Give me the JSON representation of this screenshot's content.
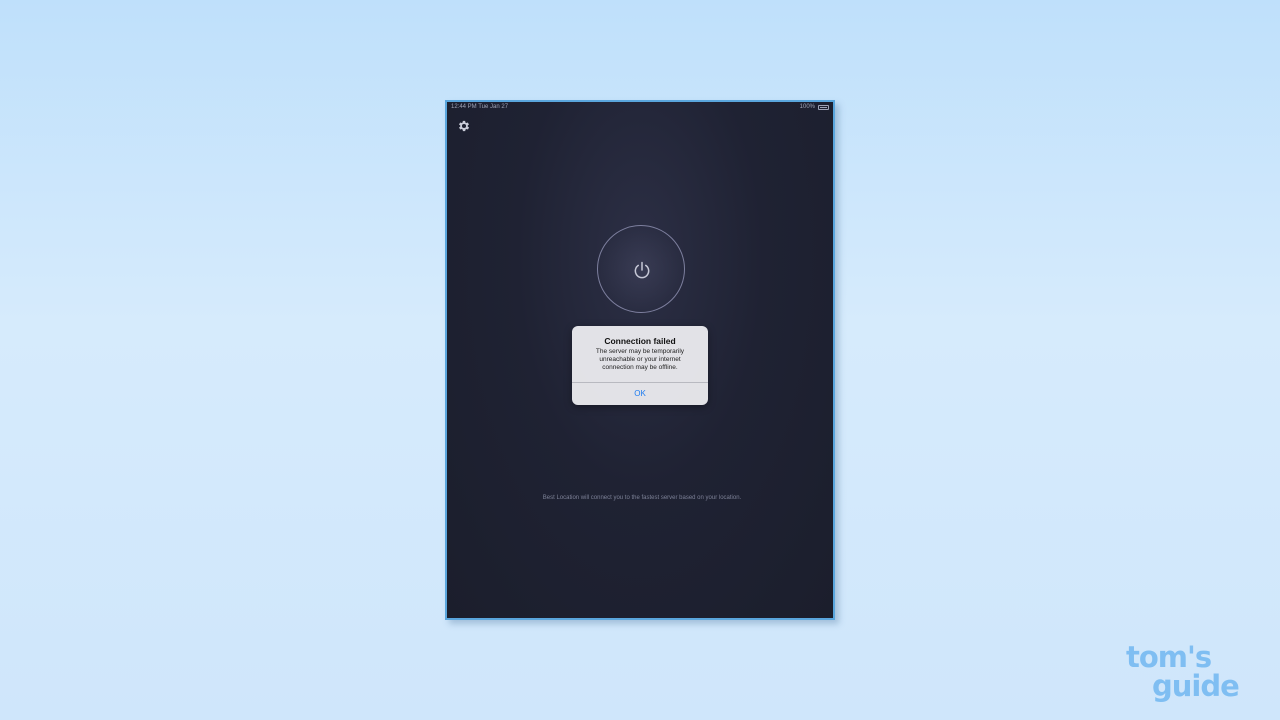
{
  "status_bar": {
    "time_date": "12:44 PM   Tue Jan 27",
    "battery": "100%"
  },
  "icons": {
    "settings": "gear-icon",
    "power": "power-icon",
    "battery": "battery-icon"
  },
  "main": {
    "footnote": "Best Location will connect you to the fastest server based on your location."
  },
  "alert": {
    "title": "Connection failed",
    "message": "The server may be temporarily unreachable or your internet connection may be offline.",
    "ok_label": "OK"
  },
  "watermark": {
    "line1": "tom's",
    "line2": "guide"
  },
  "colors": {
    "background": "#cfe6fb",
    "app_background": "#1f2233",
    "device_border": "#5aa6dd",
    "alert_button": "#1e7cf0",
    "watermark": "#7fbef2"
  }
}
